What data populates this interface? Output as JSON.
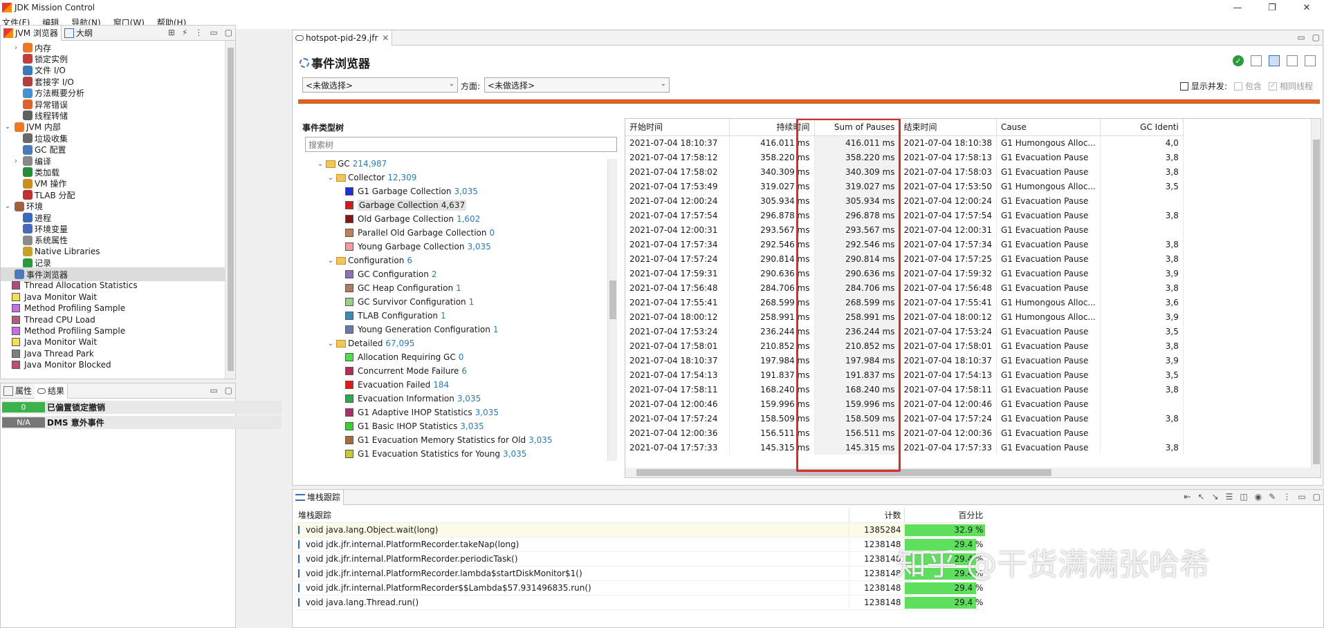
{
  "window": {
    "title": "JDK Mission Control"
  },
  "menu": [
    "文件(F)",
    "编辑",
    "导航(N)",
    "窗口(W)",
    "帮助(H)"
  ],
  "left_panel": {
    "tabs": [
      "JVM 浏览器",
      "大纲"
    ],
    "tree": [
      {
        "label": "内存",
        "indent": 1,
        "chev": "›"
      },
      {
        "label": "锁定实例",
        "indent": 1,
        "chev": ""
      },
      {
        "label": "文件 I/O",
        "indent": 1,
        "chev": ""
      },
      {
        "label": "套接字 I/O",
        "indent": 1,
        "chev": ""
      },
      {
        "label": "方法概要分析",
        "indent": 1,
        "chev": ""
      },
      {
        "label": "异常错误",
        "indent": 1,
        "chev": ""
      },
      {
        "label": "线程转储",
        "indent": 1,
        "chev": ""
      },
      {
        "label": "JVM 内部",
        "indent": 0,
        "chev": "⌄"
      },
      {
        "label": "垃圾收集",
        "indent": 1,
        "chev": ""
      },
      {
        "label": "GC 配置",
        "indent": 1,
        "chev": ""
      },
      {
        "label": "编译",
        "indent": 1,
        "chev": "›"
      },
      {
        "label": "类加载",
        "indent": 1,
        "chev": ""
      },
      {
        "label": "VM 操作",
        "indent": 1,
        "chev": ""
      },
      {
        "label": "TLAB 分配",
        "indent": 1,
        "chev": ""
      },
      {
        "label": "环境",
        "indent": 0,
        "chev": "⌄"
      },
      {
        "label": "进程",
        "indent": 1,
        "chev": ""
      },
      {
        "label": "环境变量",
        "indent": 1,
        "chev": ""
      },
      {
        "label": "系统属性",
        "indent": 1,
        "chev": ""
      },
      {
        "label": "Native Libraries",
        "indent": 1,
        "chev": ""
      },
      {
        "label": "记录",
        "indent": 1,
        "chev": ""
      },
      {
        "label": "事件浏览器",
        "indent": 0,
        "chev": "",
        "selected": true
      }
    ],
    "colored_items": [
      {
        "label": "Thread Allocation Statistics",
        "color": "#b04a80"
      },
      {
        "label": "Java Monitor Wait",
        "color": "#f4e04d"
      },
      {
        "label": "Method Profiling Sample",
        "color": "#c46ee8"
      },
      {
        "label": "Thread CPU Load",
        "color": "#b05f7a"
      },
      {
        "label": "Method Profiling Sample",
        "color": "#c46ee8"
      },
      {
        "label": "Java Monitor Wait",
        "color": "#f4e04d"
      },
      {
        "label": "Java Thread Park",
        "color": "#808080"
      },
      {
        "label": "Java Monitor Blocked",
        "color": "#c0506a"
      }
    ]
  },
  "results_panel": {
    "tabs": [
      "属性",
      "结果"
    ],
    "rows": [
      {
        "value": "0",
        "label": "已偏置锁定撤销",
        "color": "#3cb34a"
      },
      {
        "value": "N/A",
        "label": "DMS 意外事件",
        "color": "#777777"
      }
    ]
  },
  "editor": {
    "tab": "hotspot-pid-29.jfr",
    "heading": "事件浏览器",
    "filter1": "<未做选择>",
    "aspect_label": "方面:",
    "filter2": "<未做选择>",
    "show_concurrent": "显示并发:",
    "include": "包含",
    "same_thread": "相同线程",
    "tree_title": "事件类型树",
    "search_placeholder": "搜索树",
    "event_tree": [
      {
        "label": "GC",
        "count": "214,987",
        "level": 0,
        "folder": true
      },
      {
        "label": "Collector",
        "count": "12,309",
        "level": 1,
        "folder": true
      },
      {
        "label": "G1 Garbage Collection",
        "count": "3,035",
        "level": 2,
        "color": "#1f2fd8"
      },
      {
        "label": "Garbage Collection",
        "count": "4,637",
        "level": 2,
        "color": "#cc1c1c",
        "selected": true
      },
      {
        "label": "Old Garbage Collection",
        "count": "1,602",
        "level": 2,
        "color": "#8b1414"
      },
      {
        "label": "Parallel Old Garbage Collection",
        "count": "0",
        "level": 2,
        "color": "#c0805a"
      },
      {
        "label": "Young Garbage Collection",
        "count": "3,035",
        "level": 2,
        "color": "#f29ca0"
      },
      {
        "label": "Configuration",
        "count": "6",
        "level": 1,
        "folder": true
      },
      {
        "label": "GC Configuration",
        "count": "2",
        "level": 2,
        "color": "#8a74b8"
      },
      {
        "label": "GC Heap Configuration",
        "count": "1",
        "level": 2,
        "color": "#b07a68"
      },
      {
        "label": "GC Survivor Configuration",
        "count": "1",
        "level": 2,
        "color": "#9ad08a"
      },
      {
        "label": "TLAB Configuration",
        "count": "1",
        "level": 2,
        "color": "#3a8ab8"
      },
      {
        "label": "Young Generation Configuration",
        "count": "1",
        "level": 2,
        "color": "#6a7ab0"
      },
      {
        "label": "Detailed",
        "count": "67,095",
        "level": 1,
        "folder": true
      },
      {
        "label": "Allocation Requiring GC",
        "count": "0",
        "level": 2,
        "color": "#4ce04c"
      },
      {
        "label": "Concurrent Mode Failure",
        "count": "6",
        "level": 2,
        "color": "#b0305a"
      },
      {
        "label": "Evacuation Failed",
        "count": "184",
        "level": 2,
        "color": "#e81818"
      },
      {
        "label": "Evacuation Information",
        "count": "3,035",
        "level": 2,
        "color": "#2ea84a"
      },
      {
        "label": "G1 Adaptive IHOP Statistics",
        "count": "3,035",
        "level": 2,
        "color": "#a8306a"
      },
      {
        "label": "G1 Basic IHOP Statistics",
        "count": "3,035",
        "level": 2,
        "color": "#3ad030"
      },
      {
        "label": "G1 Evacuation Memory Statistics for Old",
        "count": "3,035",
        "level": 2,
        "color": "#a86a3a"
      },
      {
        "label": "G1 Evacuation Statistics for Young",
        "count": "3,035",
        "level": 2,
        "color": "#c8c838"
      }
    ],
    "table": {
      "columns": [
        "开始时间",
        "持续时间",
        "Sum of Pauses",
        "结束时间",
        "Cause",
        "GC Identi"
      ],
      "rows": [
        [
          "2021-07-04 18:10:37",
          "416.011 ms",
          "416.011 ms",
          "2021-07-04 18:10:38",
          "G1 Humongous Alloc...",
          "4,0"
        ],
        [
          "2021-07-04 17:58:12",
          "358.220 ms",
          "358.220 ms",
          "2021-07-04 17:58:13",
          "G1 Evacuation Pause",
          "3,8"
        ],
        [
          "2021-07-04 17:58:02",
          "340.309 ms",
          "340.309 ms",
          "2021-07-04 17:58:03",
          "G1 Evacuation Pause",
          "3,8"
        ],
        [
          "2021-07-04 17:53:49",
          "319.027 ms",
          "319.027 ms",
          "2021-07-04 17:53:50",
          "G1 Humongous Alloc...",
          "3,5"
        ],
        [
          "2021-07-04 12:00:24",
          "305.934 ms",
          "305.934 ms",
          "2021-07-04 12:00:24",
          "G1 Evacuation Pause",
          ""
        ],
        [
          "2021-07-04 17:57:54",
          "296.878 ms",
          "296.878 ms",
          "2021-07-04 17:57:54",
          "G1 Evacuation Pause",
          "3,8"
        ],
        [
          "2021-07-04 12:00:31",
          "293.567 ms",
          "293.567 ms",
          "2021-07-04 12:00:31",
          "G1 Evacuation Pause",
          ""
        ],
        [
          "2021-07-04 17:57:34",
          "292.546 ms",
          "292.546 ms",
          "2021-07-04 17:57:34",
          "G1 Evacuation Pause",
          "3,8"
        ],
        [
          "2021-07-04 17:57:24",
          "290.814 ms",
          "290.814 ms",
          "2021-07-04 17:57:25",
          "G1 Evacuation Pause",
          "3,8"
        ],
        [
          "2021-07-04 17:59:31",
          "290.636 ms",
          "290.636 ms",
          "2021-07-04 17:59:32",
          "G1 Evacuation Pause",
          "3,9"
        ],
        [
          "2021-07-04 17:56:48",
          "284.706 ms",
          "284.706 ms",
          "2021-07-04 17:56:48",
          "G1 Evacuation Pause",
          "3,8"
        ],
        [
          "2021-07-04 17:55:41",
          "268.599 ms",
          "268.599 ms",
          "2021-07-04 17:55:41",
          "G1 Humongous Alloc...",
          "3,6"
        ],
        [
          "2021-07-04 18:00:12",
          "258.991 ms",
          "258.991 ms",
          "2021-07-04 18:00:12",
          "G1 Humongous Alloc...",
          "3,9"
        ],
        [
          "2021-07-04 17:53:24",
          "236.244 ms",
          "236.244 ms",
          "2021-07-04 17:53:24",
          "G1 Evacuation Pause",
          "3,5"
        ],
        [
          "2021-07-04 17:58:01",
          "210.852 ms",
          "210.852 ms",
          "2021-07-04 17:58:01",
          "G1 Evacuation Pause",
          "3,8"
        ],
        [
          "2021-07-04 18:10:37",
          "197.984 ms",
          "197.984 ms",
          "2021-07-04 18:10:37",
          "G1 Evacuation Pause",
          "3,9"
        ],
        [
          "2021-07-04 17:54:13",
          "191.837 ms",
          "191.837 ms",
          "2021-07-04 17:54:13",
          "G1 Evacuation Pause",
          "3,5"
        ],
        [
          "2021-07-04 17:58:11",
          "168.240 ms",
          "168.240 ms",
          "2021-07-04 17:58:11",
          "G1 Evacuation Pause",
          "3,8"
        ],
        [
          "2021-07-04 12:00:46",
          "159.996 ms",
          "159.996 ms",
          "2021-07-04 12:00:46",
          "G1 Evacuation Pause",
          ""
        ],
        [
          "2021-07-04 17:57:24",
          "158.509 ms",
          "158.509 ms",
          "2021-07-04 17:57:24",
          "G1 Evacuation Pause",
          "3,8"
        ],
        [
          "2021-07-04 12:00:36",
          "156.511 ms",
          "156.511 ms",
          "2021-07-04 12:00:36",
          "G1 Evacuation Pause",
          ""
        ],
        [
          "2021-07-04 17:57:33",
          "145.315 ms",
          "145.315 ms",
          "2021-07-04 17:57:33",
          "G1 Evacuation Pause",
          "3,8"
        ]
      ]
    }
  },
  "stack_panel": {
    "tab": "堆栈跟踪",
    "columns": [
      "堆栈跟踪",
      "计数",
      "百分比"
    ],
    "rows": [
      {
        "frame": "void java.lang.Object.wait(long)",
        "count": "1385284",
        "pct": "32.9 %",
        "fraction": 0.329
      },
      {
        "frame": "void jdk.jfr.internal.PlatformRecorder.takeNap(long)",
        "count": "1238148",
        "pct": "29.4 %",
        "fraction": 0.294
      },
      {
        "frame": "void jdk.jfr.internal.PlatformRecorder.periodicTask()",
        "count": "1238148",
        "pct": "29.4 %",
        "fraction": 0.294
      },
      {
        "frame": "void jdk.jfr.internal.PlatformRecorder.lambda$startDiskMonitor$1()",
        "count": "1238148",
        "pct": "29.4 %",
        "fraction": 0.294
      },
      {
        "frame": "void jdk.jfr.internal.PlatformRecorder$$Lambda$57.931496835.run()",
        "count": "1238148",
        "pct": "29.4 %",
        "fraction": 0.294
      },
      {
        "frame": "void java.lang.Thread.run()",
        "count": "1238148",
        "pct": "29.4 %",
        "fraction": 0.294
      }
    ]
  },
  "watermark": "知乎 @干货满满张哈希",
  "colors": {
    "accent_bar": "#e8621c",
    "highlight_box": "#d32f2f",
    "pct_bar": "#5ee05e"
  },
  "icons": [
    "check-icon",
    "view-icon",
    "minimize-icon",
    "maximize-icon"
  ]
}
